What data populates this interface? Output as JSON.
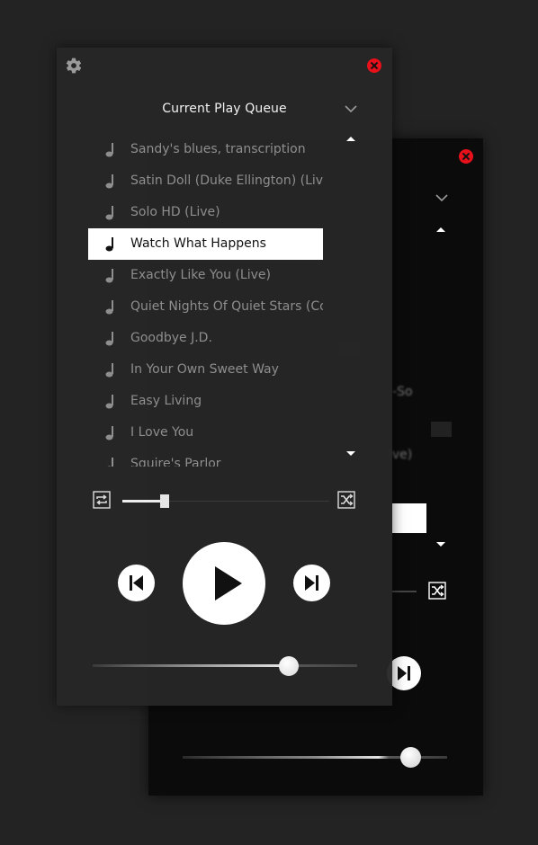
{
  "queue_panel": {
    "title": "Current Play Queue",
    "items": [
      {
        "label": "Sandy's blues, transcription"
      },
      {
        "label": "Satin Doll (Duke Ellington) (Live)"
      },
      {
        "label": "Solo HD (Live)"
      },
      {
        "label": "Watch What Happens"
      },
      {
        "label": "Exactly Like You (Live)"
      },
      {
        "label": "Quiet Nights Of Quiet Stars (Corcovado) (Live)"
      },
      {
        "label": "Goodbye J.D."
      },
      {
        "label": "In Your Own Sweet Way"
      },
      {
        "label": "Easy Living"
      },
      {
        "label": "I Love You"
      },
      {
        "label": "Squire's Parlor"
      }
    ],
    "active_index": 3,
    "volume_level": 0.2,
    "seek_position": 0.74
  },
  "back_panel": {
    "partial_text_1": "-So",
    "partial_text_2": "ive)",
    "seek_position": 0.86
  },
  "colors": {
    "background": "#232323",
    "front_panel": "#262626",
    "back_panel": "#0b0b0b",
    "close_button": "#e8101a",
    "active_row": "#ffffff",
    "inactive_text": "#8e8e8e"
  },
  "icons": {
    "settings": "gear-icon",
    "close": "close-icon",
    "dropdown": "chevron-down-icon",
    "scroll_up": "triangle-up-icon",
    "scroll_down": "triangle-down-icon",
    "track": "music-note-icon",
    "repeat": "repeat-icon",
    "shuffle": "shuffle-icon",
    "previous": "skip-previous-icon",
    "play": "play-icon",
    "next": "skip-next-icon"
  }
}
